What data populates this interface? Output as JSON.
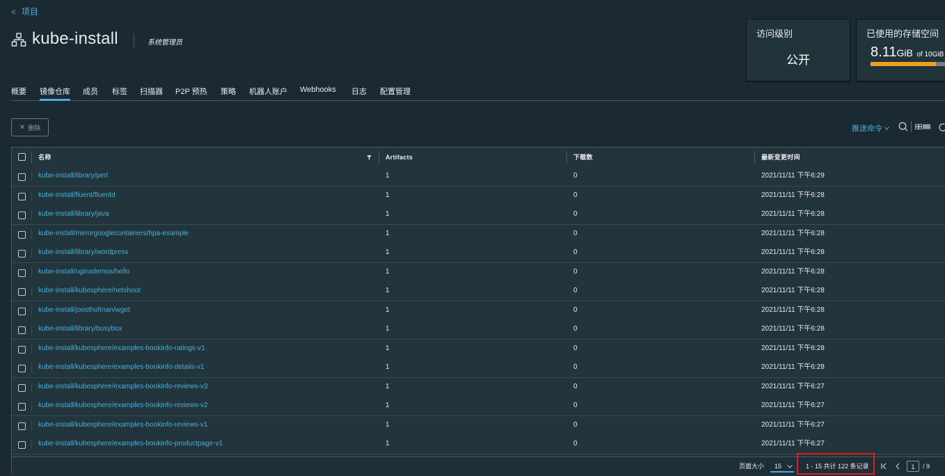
{
  "breadcrumb": {
    "back_label": "项目"
  },
  "project": {
    "name": "kube-install",
    "role": "系统管理员"
  },
  "cards": {
    "access": {
      "title": "访问级别",
      "value": "公开"
    },
    "storage": {
      "title": "已使用的存储空间",
      "used": "8.11",
      "unit": "GiB",
      "of_label": "of 10GiB",
      "usage_fraction": 0.811
    }
  },
  "tabs": [
    "概要",
    "镜像仓库",
    "成员",
    "标签",
    "扫描器",
    "P2P 预热",
    "策略",
    "机器人账户",
    "Webhooks",
    "日志",
    "配置管理"
  ],
  "active_tab": "镜像仓库",
  "toolbar": {
    "delete_label": "删除",
    "push_command_label": "推送命令"
  },
  "table": {
    "columns": [
      "名称",
      "Artifacts",
      "下载数",
      "最新变更时间"
    ],
    "rows": [
      {
        "name": "kube-install/library/perl",
        "artifacts": "1",
        "pulls": "0",
        "updated": "2021/11/11 下午6:29"
      },
      {
        "name": "kube-install/fluent/fluentd",
        "artifacts": "1",
        "pulls": "0",
        "updated": "2021/11/11 下午6:28"
      },
      {
        "name": "kube-install/library/java",
        "artifacts": "1",
        "pulls": "0",
        "updated": "2021/11/11 下午6:28"
      },
      {
        "name": "kube-install/mirrorgooglecontainers/hpa-example",
        "artifacts": "1",
        "pulls": "0",
        "updated": "2021/11/11 下午6:28"
      },
      {
        "name": "kube-install/library/wordpress",
        "artifacts": "1",
        "pulls": "0",
        "updated": "2021/11/11 下午6:28"
      },
      {
        "name": "kube-install/nginxdemos/hello",
        "artifacts": "1",
        "pulls": "0",
        "updated": "2021/11/11 下午6:28"
      },
      {
        "name": "kube-install/kubesphere/netshoot",
        "artifacts": "1",
        "pulls": "0",
        "updated": "2021/11/11 下午6:28"
      },
      {
        "name": "kube-install/joosthofman/wget",
        "artifacts": "1",
        "pulls": "0",
        "updated": "2021/11/11 下午6:28"
      },
      {
        "name": "kube-install/library/busybox",
        "artifacts": "1",
        "pulls": "0",
        "updated": "2021/11/11 下午6:28"
      },
      {
        "name": "kube-install/kubesphere/examples-bookinfo-ratings-v1",
        "artifacts": "1",
        "pulls": "0",
        "updated": "2021/11/11 下午6:28"
      },
      {
        "name": "kube-install/kubesphere/examples-bookinfo-details-v1",
        "artifacts": "1",
        "pulls": "0",
        "updated": "2021/11/11 下午6:28"
      },
      {
        "name": "kube-install/kubesphere/examples-bookinfo-reviews-v3",
        "artifacts": "1",
        "pulls": "0",
        "updated": "2021/11/11 下午6:27"
      },
      {
        "name": "kube-install/kubesphere/examples-bookinfo-reviews-v2",
        "artifacts": "1",
        "pulls": "0",
        "updated": "2021/11/11 下午6:27"
      },
      {
        "name": "kube-install/kubesphere/examples-bookinfo-reviews-v1",
        "artifacts": "1",
        "pulls": "0",
        "updated": "2021/11/11 下午6:27"
      },
      {
        "name": "kube-install/kubesphere/examples-bookinfo-productpage-v1",
        "artifacts": "1",
        "pulls": "0",
        "updated": "2021/11/11 下午6:27"
      }
    ]
  },
  "footer": {
    "page_size_label": "页面大小",
    "page_size": "15",
    "range_text": "1 - 15 共计 122 条记录",
    "current_page": "1",
    "total_pages": "/ 9"
  },
  "colors": {
    "accent": "#49afd9",
    "background": "#1b2a32",
    "highlight": "#e02020",
    "storage_bar": "#efa021"
  }
}
